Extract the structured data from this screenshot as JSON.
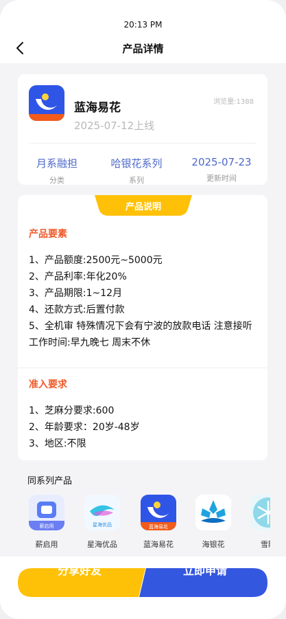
{
  "status_bar": {
    "time": "20:13 PM"
  },
  "nav": {
    "title": "产品详情"
  },
  "product": {
    "name": "蓝海易花",
    "date": "2025-07-12上线",
    "views": "浏览量:1388",
    "logo_text": "蓝海易花",
    "meta": [
      {
        "value": "月系融担",
        "label": "分类"
      },
      {
        "value": "哈银花系列",
        "label": "系列"
      },
      {
        "value": "2025-07-23",
        "label": "更新时间"
      }
    ]
  },
  "description": {
    "ribbon": "产品说明",
    "elements_title": "产品要素",
    "elements": [
      "1、产品额度:2500元~5000元",
      "2、产品利率:年化20%",
      "3、产品期限:1~12月",
      "4、还款方式:后置付款",
      "5、全机审 特殊情况下会有宁波的放款电话 注意接听工作时间:早九晚七 周末不休"
    ],
    "requirements_title": "准入要求",
    "requirements": [
      "1、芝麻分要求:600",
      "2、年龄要求：20岁-48岁",
      "3、地区:不限"
    ]
  },
  "series": {
    "title": "同系列产品",
    "items": [
      {
        "name": "薪启用",
        "badge": "薪启用"
      },
      {
        "name": "星海优品",
        "badge": "星海优品"
      },
      {
        "name": "蓝海易花",
        "badge": "蓝海易花"
      },
      {
        "name": "海银花",
        "badge": ""
      },
      {
        "name": "雪融",
        "badge": ""
      }
    ]
  },
  "actions": {
    "share": "分享好友",
    "apply": "立即申请"
  },
  "colors": {
    "accent_blue": "#3457e0",
    "accent_yellow": "#ffc107",
    "section_red": "#ef5a2a",
    "meta_blue": "#4d68c9"
  }
}
